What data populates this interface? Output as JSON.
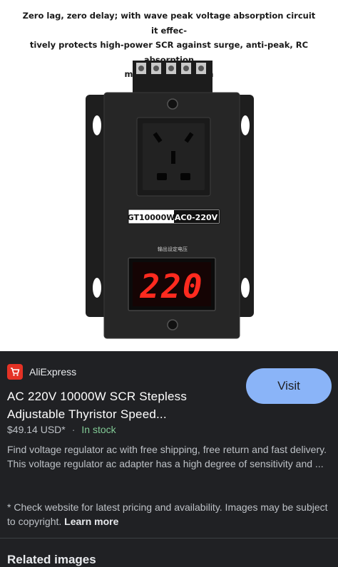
{
  "image": {
    "caption_line1": "Zero lag, zero delay; with wave peak voltage absorption circuit it effec-",
    "caption_line2": "tively protects high-power SCR against surge, anti-peak, RC absorption",
    "caption_line3": "multiple protection",
    "model_label": "GT10000W",
    "voltage_label": "AC0-220V",
    "chinese_label": "输出设定电压",
    "display_value": "220"
  },
  "result": {
    "source": "AliExpress",
    "title_line1": "AC 220V 10000W SCR Stepless",
    "title_line2": "Adjustable Thyristor Speed...",
    "price": "$49.14 USD*",
    "separator": "·",
    "stock": "In stock",
    "description": "Find voltage regulator ac with free shipping, free return and fast delivery. This voltage regulator ac adapter has a high degree of sensitivity and ...",
    "notice": "* Check website for latest pricing and availability. Images may be subject to copyright.",
    "learn_more": "Learn more",
    "visit_label": "Visit",
    "related_heading": "Related images"
  },
  "colors": {
    "panel_bg": "#202124",
    "visit_button": "#8ab4f8",
    "in_stock": "#81c995",
    "aliexpress_red": "#e43225",
    "led_red": "#ff2a1f"
  }
}
